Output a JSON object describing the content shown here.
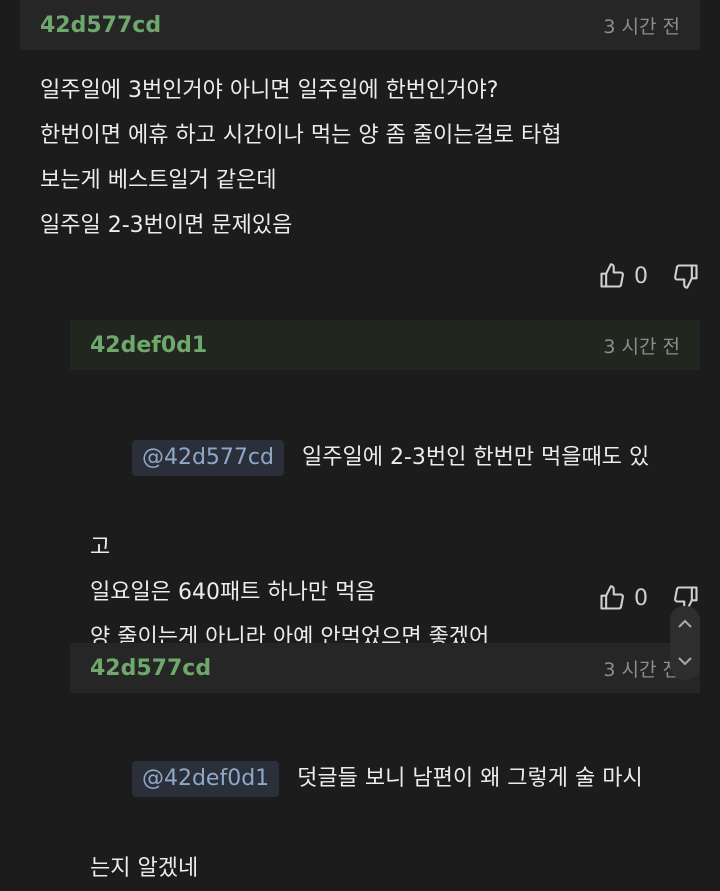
{
  "comments": [
    {
      "author": "42d577cd",
      "time": "3 시간 전",
      "text": "일주일에 3번인거야 아니면 일주일에 한번인거야?\n한번이면 에휴 하고 시간이나 먹는 양 좀 줄이는걸로 타협\n보는게 베스트일거 같은데\n일주일 2-3번이면 문제있음",
      "likes": "0"
    },
    {
      "author": "42def0d1",
      "time": "3 시간 전",
      "mention": "@42d577cd",
      "text_first": "일주일에 2-3번인 한번만 먹을때도 있",
      "text_rest": "고\n일요일은 640패트 하나만 먹음\n양 줄이는게 아니라 아예 안먹었으면 좋겠어",
      "likes": "0"
    },
    {
      "author": "42d577cd",
      "time": "3 시간 전",
      "mention": "@42def0d1",
      "text_first": "덧글들 보니 남편이 왜 그렇게 술 마시",
      "text_rest": "는지 알겠네"
    }
  ],
  "icons": {
    "like": "thumbs-up-icon",
    "dislike": "thumbs-down-icon",
    "scroll_up": "chevron-up-icon",
    "scroll_down": "chevron-down-icon"
  },
  "colors": {
    "background": "#1c1c1c",
    "author": "#6fa86c",
    "mention_bg": "#2b2f3a",
    "mention_fg": "#8fa8c8"
  }
}
